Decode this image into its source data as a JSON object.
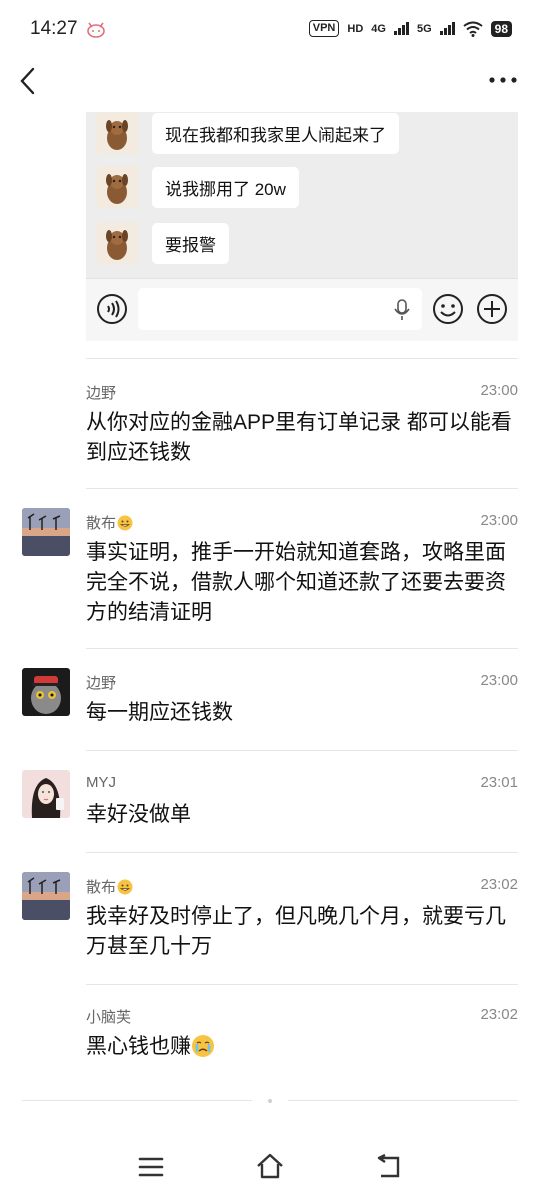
{
  "status_bar": {
    "time": "14:27",
    "vpn": "VPN",
    "hd": "HD",
    "net1": "4G",
    "net2": "5G",
    "battery": "98"
  },
  "chat_card": {
    "messages": [
      {
        "text": "现在我都和我家里人闹起来了"
      },
      {
        "text": "说我挪用了 20w"
      },
      {
        "text": "要报警"
      }
    ]
  },
  "comments": [
    {
      "name": "边野",
      "time": "23:00",
      "text": "从你对应的金融APP里有订单记录 都可以能看到应还钱数",
      "avatar": "none"
    },
    {
      "name": "散布",
      "time": "23:00",
      "text": "事实证明，推手一开始就知道套路，攻略里面完全不说，借款人哪个知道还款了还要去要资方的结清证明",
      "avatar": "sunset"
    },
    {
      "name": "边野",
      "time": "23:00",
      "text": "每一期应还钱数",
      "avatar": "cat"
    },
    {
      "name": "MYJ",
      "time": "23:01",
      "text": "幸好没做单",
      "avatar": "girl"
    },
    {
      "name": "散布",
      "time": "23:02",
      "text": "我幸好及时停止了，但凡晚几个月，就要亏几万甚至几十万",
      "avatar": "sunset"
    },
    {
      "name": "小脑芙",
      "time": "23:02",
      "text": "黑心钱也赚",
      "avatar": "none"
    }
  ],
  "colors": {
    "bubble_bg": "#ffffff",
    "card_bg": "#ededed",
    "name_text": "#666666",
    "time_text": "#888888"
  }
}
